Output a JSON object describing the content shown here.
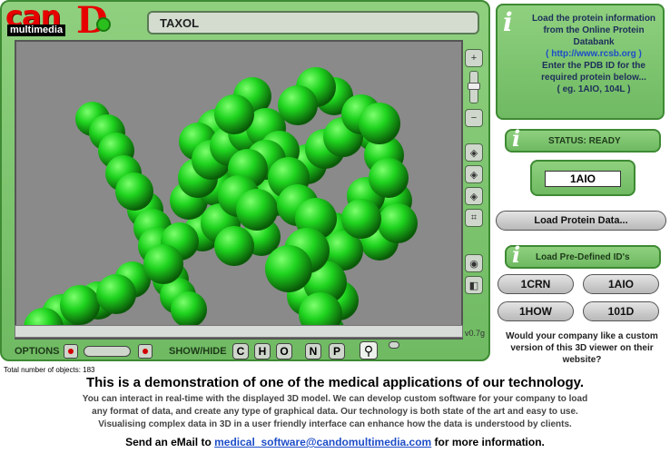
{
  "logo": {
    "cand": "can",
    "big_d": "D",
    "multimedia": "multimedia"
  },
  "viewer": {
    "title": "TAXOL",
    "version": "v0.7g"
  },
  "toolbar": {
    "options_label": "OPTIONS",
    "showhide_label": "SHOW/HIDE",
    "toggles": [
      "C",
      "H",
      "O",
      "N",
      "P"
    ]
  },
  "stats": {
    "total_objects": "Total number of objects: 183"
  },
  "info": {
    "line1": "Load the protein information from the Online Protein Databank",
    "link": "( http://www.rcsb.org )",
    "line2": "Enter the PDB ID for the required protein below...",
    "line3": "( eg. 1AIO, 104L )"
  },
  "status": {
    "label": "STATUS: READY"
  },
  "pdb": {
    "value": "1AIO"
  },
  "buttons": {
    "load": "Load Protein Data...",
    "predefined_label": "Load Pre-Defined ID's",
    "ids": [
      "1CRN",
      "1AIO",
      "1HOW",
      "101D"
    ]
  },
  "custom_text": "Would your company like a custom version of this 3D viewer on their website?",
  "footer": {
    "headline": "This is a demonstration of one of the medical applications of our technology.",
    "lines": [
      "You can interact in real-time with the displayed 3D model.  We can develop custom software for your company to load",
      "any format of data, and create any type of graphical data.  Our technology is both state of the art and easy to use.",
      "Visualising complex data in 3D in a user friendly interface can enhance how the data is understood by clients."
    ],
    "email_prefix": "Send an eMail to ",
    "email": "medical_software@candomultimedia.com",
    "email_suffix": " for more information."
  },
  "colors": {
    "frame_green": "#7cc46d",
    "atom_green": "#1fd41f",
    "link_blue": "#1d4dc8",
    "record_red": "#d10000"
  }
}
